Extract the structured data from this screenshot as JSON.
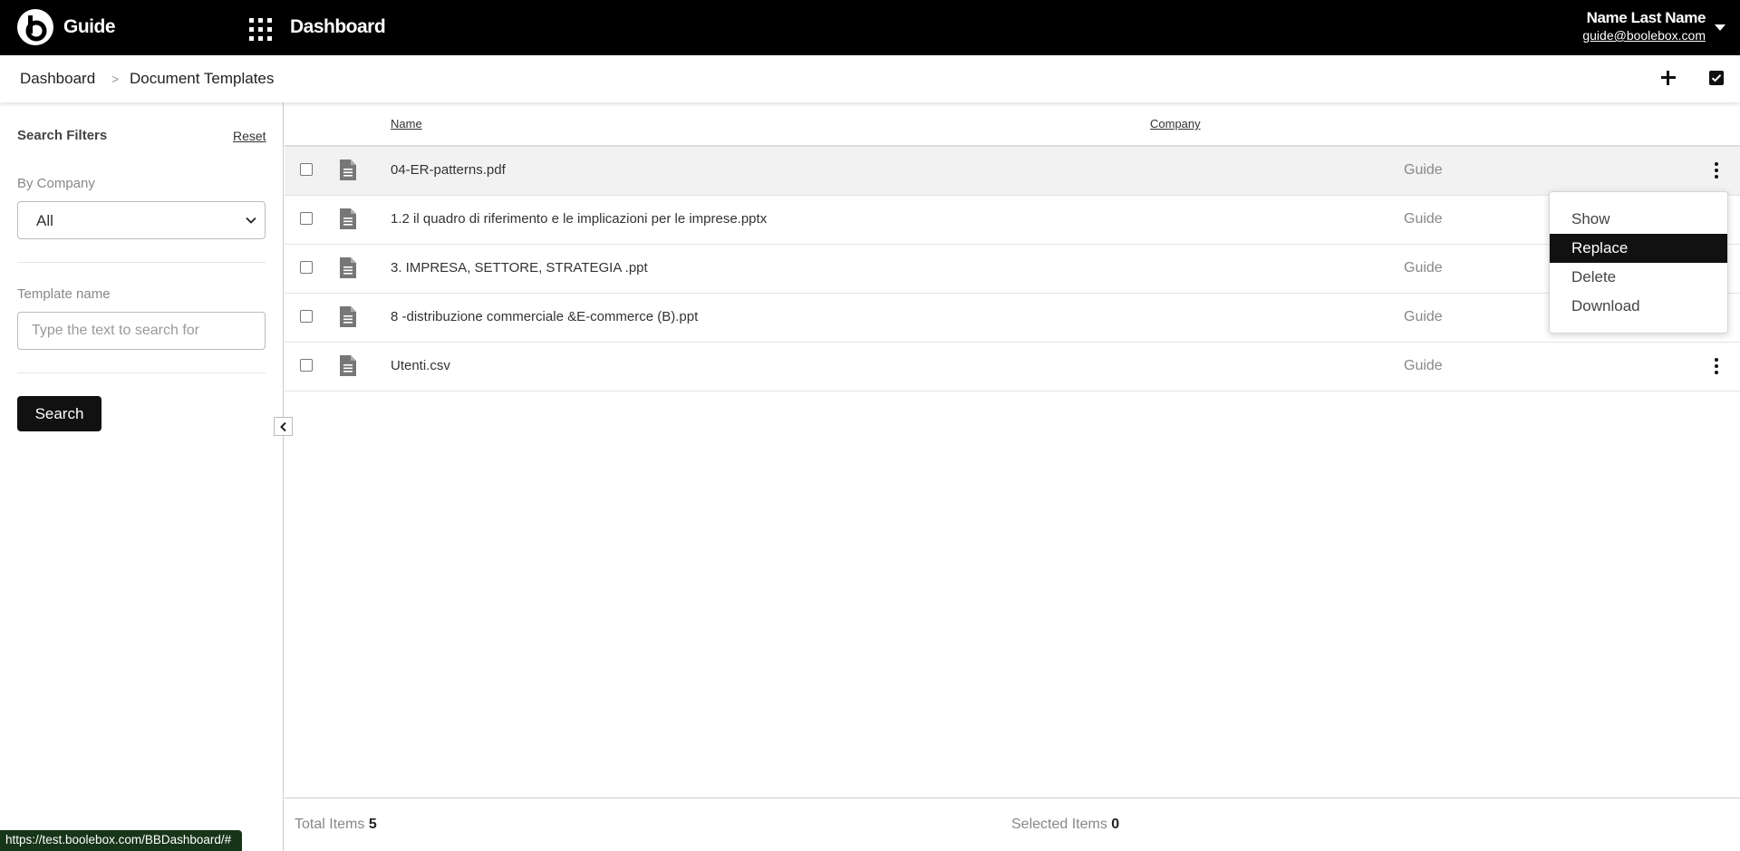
{
  "header": {
    "app_name": "Guide",
    "page_name": "Dashboard",
    "user_name": "Name Last Name",
    "user_email": "guide@boolebox.com",
    "background": "#000000"
  },
  "breadcrumb": {
    "items": [
      "Dashboard",
      "Document Templates"
    ],
    "separator": ">"
  },
  "toolbar": {
    "add_icon": "plus-icon",
    "select_all_icon": "checkbox-checked-icon"
  },
  "sidebar": {
    "title": "Search Filters",
    "reset_label": "Reset",
    "company_label": "By Company",
    "company_value": "All",
    "template_label": "Template name",
    "template_placeholder": "Type the text to search for",
    "search_label": "Search"
  },
  "table": {
    "columns": [
      "Name",
      "Company"
    ],
    "rows": [
      {
        "name": "04-ER-patterns.pdf",
        "company": "Guide"
      },
      {
        "name": "1.2 il quadro di riferimento e le implicazioni per le imprese.pptx",
        "company": "Guide"
      },
      {
        "name": "3. IMPRESA, SETTORE, STRATEGIA .ppt",
        "company": "Guide"
      },
      {
        "name": "8 -distribuzione commerciale &E-commerce (B).ppt",
        "company": "Guide"
      },
      {
        "name": "Utenti.csv",
        "company": "Guide"
      }
    ]
  },
  "context_menu": {
    "items": [
      "Show",
      "Replace",
      "Delete",
      "Download"
    ],
    "highlighted": "Replace"
  },
  "footer": {
    "total_label": "Total Items",
    "total_value": "5",
    "selected_label": "Selected Items",
    "selected_value": "0"
  },
  "status_url": "https://test.boolebox.com/BBDashboard/#"
}
